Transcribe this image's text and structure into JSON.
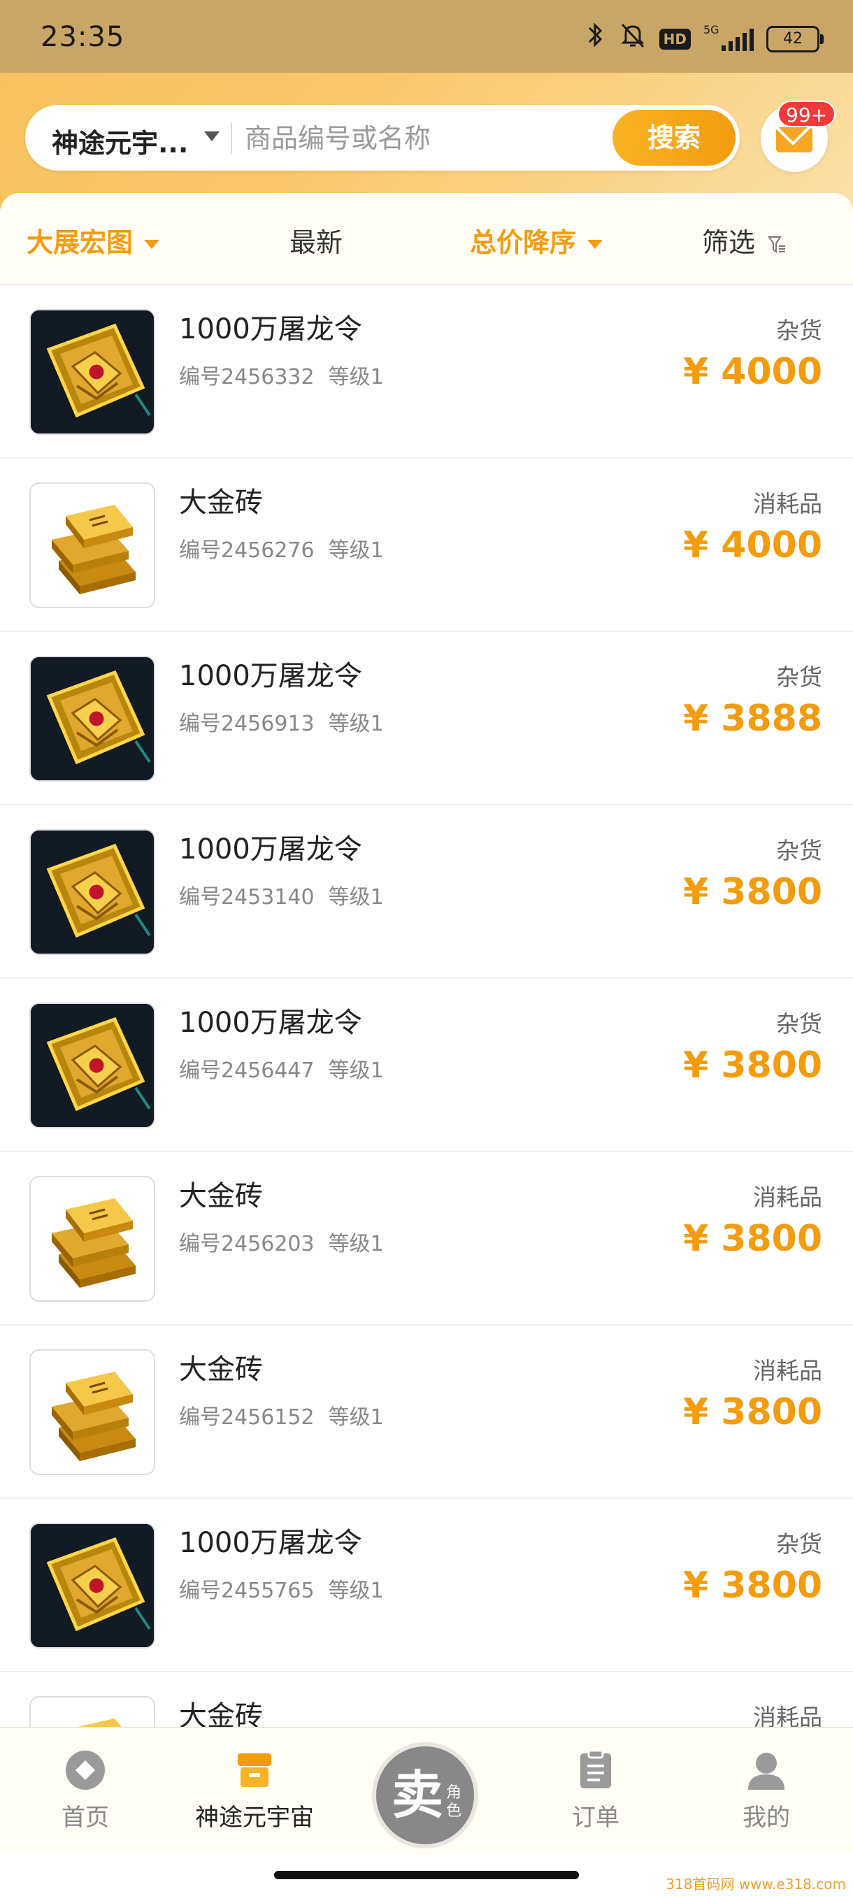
{
  "status_bar": {
    "time": "23:35",
    "network": "5G",
    "hd_badge": "HD",
    "battery": "42"
  },
  "search": {
    "game_selector": "神途元宇...",
    "placeholder": "商品编号或名称",
    "button_label": "搜索",
    "mail_badge": "99+"
  },
  "filters": {
    "server": "大展宏图",
    "latest": "最新",
    "sort": "总价降序",
    "filter": "筛选"
  },
  "items": [
    {
      "title": "1000万屠龙令",
      "id_label": "编号2456332",
      "level_label": "等级1",
      "category": "杂货",
      "price": "¥ 4000",
      "image": "dragon-token"
    },
    {
      "title": "大金砖",
      "id_label": "编号2456276",
      "level_label": "等级1",
      "category": "消耗品",
      "price": "¥ 4000",
      "image": "gold-bars"
    },
    {
      "title": "1000万屠龙令",
      "id_label": "编号2456913",
      "level_label": "等级1",
      "category": "杂货",
      "price": "¥ 3888",
      "image": "dragon-token"
    },
    {
      "title": "1000万屠龙令",
      "id_label": "编号2453140",
      "level_label": "等级1",
      "category": "杂货",
      "price": "¥ 3800",
      "image": "dragon-token"
    },
    {
      "title": "1000万屠龙令",
      "id_label": "编号2456447",
      "level_label": "等级1",
      "category": "杂货",
      "price": "¥ 3800",
      "image": "dragon-token"
    },
    {
      "title": "大金砖",
      "id_label": "编号2456203",
      "level_label": "等级1",
      "category": "消耗品",
      "price": "¥ 3800",
      "image": "gold-bars"
    },
    {
      "title": "大金砖",
      "id_label": "编号2456152",
      "level_label": "等级1",
      "category": "消耗品",
      "price": "¥ 3800",
      "image": "gold-bars"
    },
    {
      "title": "1000万屠龙令",
      "id_label": "编号2455765",
      "level_label": "等级1",
      "category": "杂货",
      "price": "¥ 3800",
      "image": "dragon-token"
    },
    {
      "title": "大金砖",
      "id_label": "",
      "level_label": "",
      "category": "消耗品",
      "price": "",
      "image": "gold-bars"
    }
  ],
  "nav": {
    "home": "首页",
    "game": "神途元宇宙",
    "sell_main": "卖",
    "sell_sub": "角色",
    "orders": "订单",
    "mine": "我的"
  },
  "watermark": "318首码网 www.e318.com",
  "colors": {
    "accent": "#f39c0e",
    "header": "#f7c05a",
    "badge": "#f23a3a"
  }
}
